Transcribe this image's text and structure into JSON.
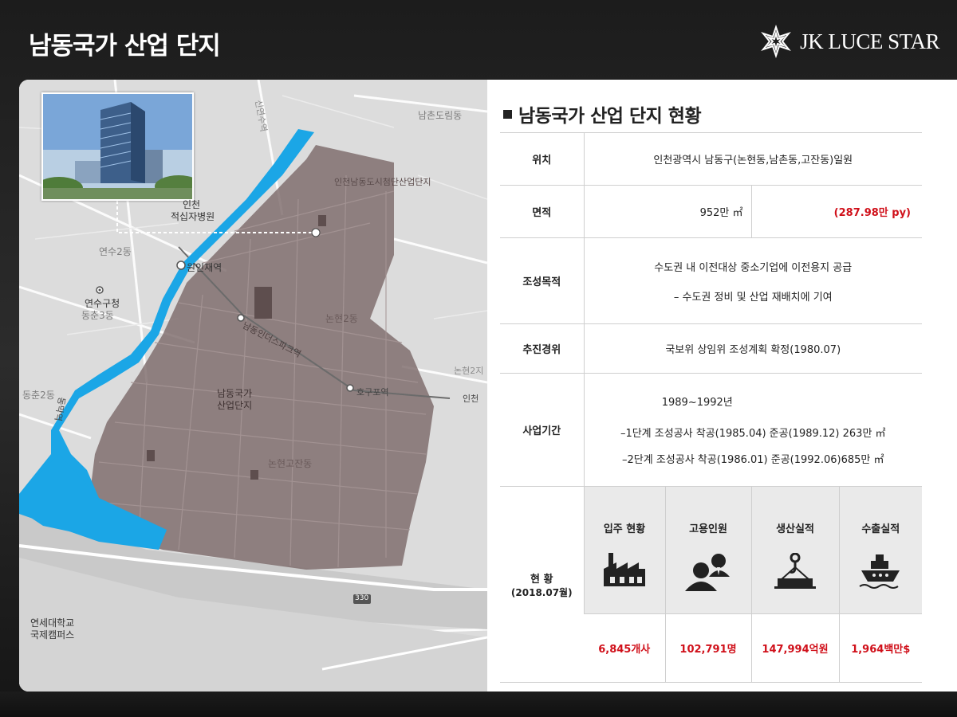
{
  "header": {
    "title": "남동국가 산업 단지",
    "logo_text": "JK LUCE STAR"
  },
  "map": {
    "labels": {
      "namchon_dorim": "남촌도림동",
      "park_name": "인천남동도시첨단산업단지",
      "incheon_hospital_1": "인천",
      "incheon_hospital_2": "적십자병원",
      "woninjae": "원인재역",
      "yeonsu2": "연수2동",
      "yeonsugu_office": "연수구청",
      "dongchun3": "동춘3동",
      "namdong_industrial_station": "남동인더스파크역",
      "nonhyeon2": "논현2동",
      "nonhyeon2_right": "논현2지",
      "hogupo": "호구포역",
      "complex_1": "남동국가",
      "complex_2": "산업단지",
      "dongchun2": "동춘2동",
      "nonhyeon_gojan": "논현고잔동",
      "dongmak": "동막역",
      "yonsei_1": "연세대학교",
      "yonsei_2": "국제캠퍼스",
      "route_330": "330",
      "incheon_right": "인천",
      "sinyeonsu": "신연수역"
    }
  },
  "info": {
    "section_title": "남동국가 산업 단지 현황",
    "location": {
      "label": "위치",
      "value": "인천광역시 남동구(논현동,남촌동,고잔동)일원"
    },
    "area": {
      "label": "면적",
      "value_m2": "952만 ㎡",
      "value_py": "(287.98만 py)"
    },
    "purpose": {
      "label": "조성목적",
      "line1": "수도권 내 이전대상 중소기업에 이전용지 공급",
      "line2": "–  수도권 정비 및 산업 재배치에 기여"
    },
    "history": {
      "label": "추진경위",
      "value": "국보위 상임위 조성계획 확정(1980.07)"
    },
    "period": {
      "label": "사업기간",
      "line1": "1989~1992년",
      "line2": "–1단계 조성공사 착공(1985.04) 준공(1989.12) 263만 ㎡",
      "line3": "–2단계 조성공사 착공(1986.01) 준공(1992.06)685만 ㎡"
    },
    "status": {
      "label": "현 황",
      "date": "(2018.07월)",
      "columns": [
        {
          "header": "입주 현황",
          "icon": "factory-icon",
          "value": "6,845개사"
        },
        {
          "header": "고용인원",
          "icon": "people-icon",
          "value": "102,791명"
        },
        {
          "header": "생산실적",
          "icon": "crane-hook-icon",
          "value": "147,994억원"
        },
        {
          "header": "수출실적",
          "icon": "ship-icon",
          "value": "1,964백만$"
        }
      ]
    }
  },
  "colors": {
    "accent_red": "#d0101a",
    "river_blue": "#1ba6e6",
    "complex_fill": "#7c6a6a"
  }
}
